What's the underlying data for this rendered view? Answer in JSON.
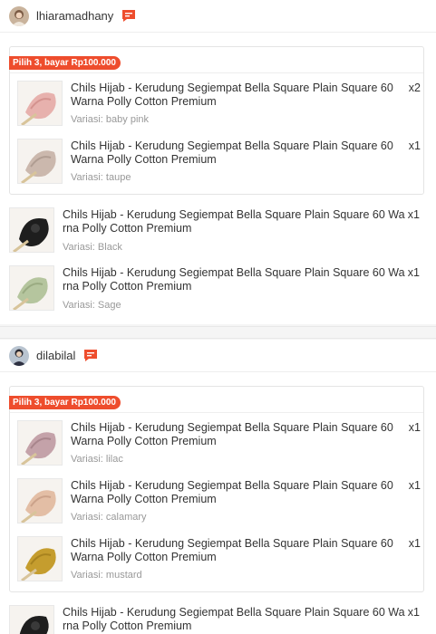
{
  "colors": {
    "brand": "#ee4d2d",
    "badge_text": "#ffffff",
    "muted_text": "#999999"
  },
  "orders": [
    {
      "seller": {
        "name": "lhiaramadhany",
        "avatar_icon": "user-avatar-icon",
        "chat_icon": "chat-bubble-icon"
      },
      "bundle": {
        "badge": "Pilih 3, bayar Rp100.000",
        "items": [
          {
            "title": "Chils Hijab - Kerudung Segiempat Bella Square Plain Square 60 Warna Polly Cotton Premium",
            "variant": "Variasi: baby pink",
            "qty": "x2",
            "swatch": "#e7b1ad"
          },
          {
            "title": "Chils Hijab - Kerudung Segiempat Bella Square Plain Square 60 Warna Polly Cotton Premium",
            "variant": "Variasi: taupe",
            "qty": "x1",
            "swatch": "#cbb8ad"
          }
        ]
      },
      "items": [
        {
          "title": "Chils Hijab - Kerudung Segiempat Bella Square Plain Square 60 Wa rna Polly Cotton Premium",
          "variant": "Variasi: Black",
          "qty": "x1",
          "swatch": "#1e1e1e"
        },
        {
          "title": "Chils Hijab - Kerudung Segiempat Bella Square Plain Square 60 Wa rna Polly Cotton Premium",
          "variant": "Variasi: Sage",
          "qty": "x1",
          "swatch": "#b5c59e"
        }
      ]
    },
    {
      "seller": {
        "name": "dilabilal",
        "avatar_icon": "user-avatar-icon",
        "chat_icon": "chat-bubble-icon"
      },
      "bundle": {
        "badge": "Pilih 3, bayar Rp100.000",
        "items": [
          {
            "title": "Chils Hijab - Kerudung Segiempat Bella Square Plain Square 60 Warna Polly Cotton Premium",
            "variant": "Variasi: lilac",
            "qty": "x1",
            "swatch": "#c4a2a9"
          },
          {
            "title": "Chils Hijab - Kerudung Segiempat Bella Square Plain Square 60 Warna Polly Cotton Premium",
            "variant": "Variasi: calamary",
            "qty": "x1",
            "swatch": "#e3bea5"
          },
          {
            "title": "Chils Hijab - Kerudung Segiempat Bella Square Plain Square 60 Warna Polly Cotton Premium",
            "variant": "Variasi: mustard",
            "qty": "x1",
            "swatch": "#c59d2e"
          }
        ]
      },
      "items": [
        {
          "title": "Chils Hijab - Kerudung Segiempat Bella Square Plain Square 60 Wa rna Polly Cotton Premium",
          "variant": "",
          "qty": "x1",
          "swatch": "#1e1e1e"
        }
      ]
    }
  ]
}
